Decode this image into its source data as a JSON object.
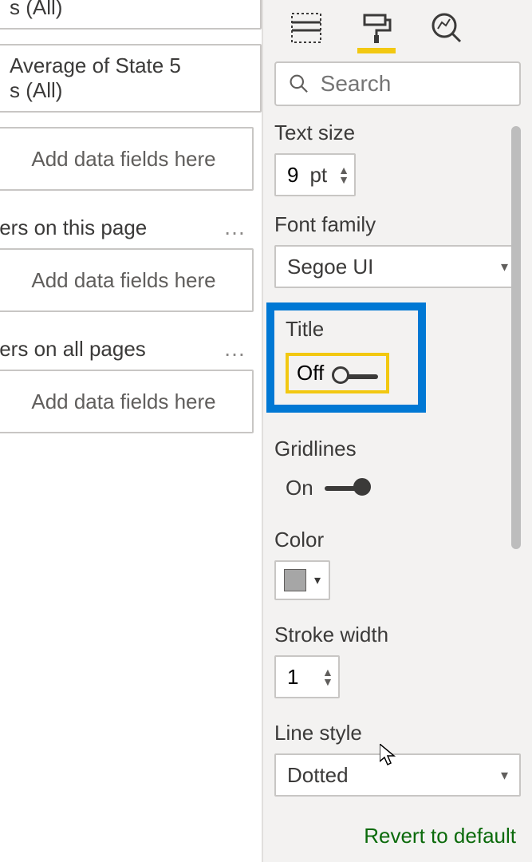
{
  "left": {
    "filter1": {
      "line1": "s (All)"
    },
    "filter2": {
      "line1": "Average of State 5",
      "line2": "s (All)"
    },
    "drop_placeholder": "Add data fields here",
    "section_page": "ters on this page",
    "section_all": "ters on all pages"
  },
  "tabs": {
    "fields": "fields",
    "format": "format",
    "analytics": "analytics"
  },
  "search": {
    "placeholder": "Search"
  },
  "format": {
    "text_size_label": "Text size",
    "text_size_value": "9",
    "text_size_unit": "pt",
    "font_family_label": "Font family",
    "font_family_value": "Segoe UI",
    "title_label": "Title",
    "title_state": "Off",
    "gridlines_label": "Gridlines",
    "gridlines_state": "On",
    "color_label": "Color",
    "color_value": "#a6a6a6",
    "stroke_label": "Stroke width",
    "stroke_value": "1",
    "line_style_label": "Line style",
    "line_style_value": "Dotted",
    "revert": "Revert to default"
  }
}
